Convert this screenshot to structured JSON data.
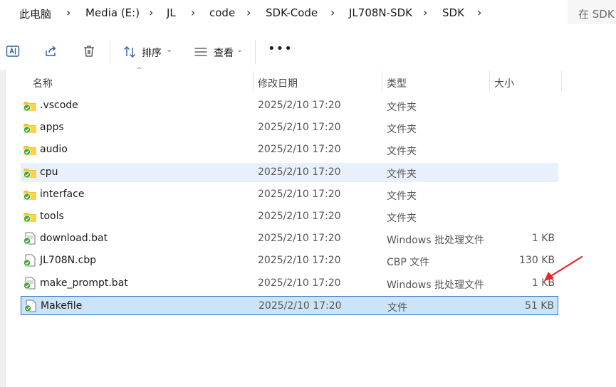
{
  "breadcrumb": [
    "此电脑",
    "Media (E:)",
    "JL",
    "code",
    "SDK-Code",
    "JL708N-SDK",
    "SDK"
  ],
  "search_placeholder": "在 SDK",
  "toolbar": {
    "sort_label": "排序",
    "view_label": "查看",
    "more_label": "•••"
  },
  "columns": {
    "name": "名称",
    "date": "修改日期",
    "type": "类型",
    "size": "大小"
  },
  "files": [
    {
      "name": ".vscode",
      "date": "2025/2/10 17:20",
      "type": "文件夹",
      "size": "",
      "kind": "folder"
    },
    {
      "name": "apps",
      "date": "2025/2/10 17:20",
      "type": "文件夹",
      "size": "",
      "kind": "folder"
    },
    {
      "name": "audio",
      "date": "2025/2/10 17:20",
      "type": "文件夹",
      "size": "",
      "kind": "folder"
    },
    {
      "name": "cpu",
      "date": "2025/2/10 17:20",
      "type": "文件夹",
      "size": "",
      "kind": "folder",
      "state": "hover"
    },
    {
      "name": "interface",
      "date": "2025/2/10 17:20",
      "type": "文件夹",
      "size": "",
      "kind": "folder"
    },
    {
      "name": "tools",
      "date": "2025/2/10 17:20",
      "type": "文件夹",
      "size": "",
      "kind": "folder"
    },
    {
      "name": "download.bat",
      "date": "2025/2/10 17:20",
      "type": "Windows 批处理文件",
      "size": "1 KB",
      "kind": "bat"
    },
    {
      "name": "JL708N.cbp",
      "date": "2025/2/10 17:20",
      "type": "CBP 文件",
      "size": "130 KB",
      "kind": "file"
    },
    {
      "name": "make_prompt.bat",
      "date": "2025/2/10 17:20",
      "type": "Windows 批处理文件",
      "size": "1 KB",
      "kind": "bat"
    },
    {
      "name": "Makefile",
      "date": "2025/2/10 17:20",
      "type": "文件",
      "size": "51 KB",
      "kind": "file",
      "state": "selected"
    }
  ],
  "colors": {
    "selected_bg": "#cce4f7",
    "selected_border": "#2f78c4",
    "hover_bg": "#e8f1fb",
    "folder": "#f4c430",
    "sync_badge": "#3aaa35",
    "annotation_arrow": "#e8252b"
  }
}
